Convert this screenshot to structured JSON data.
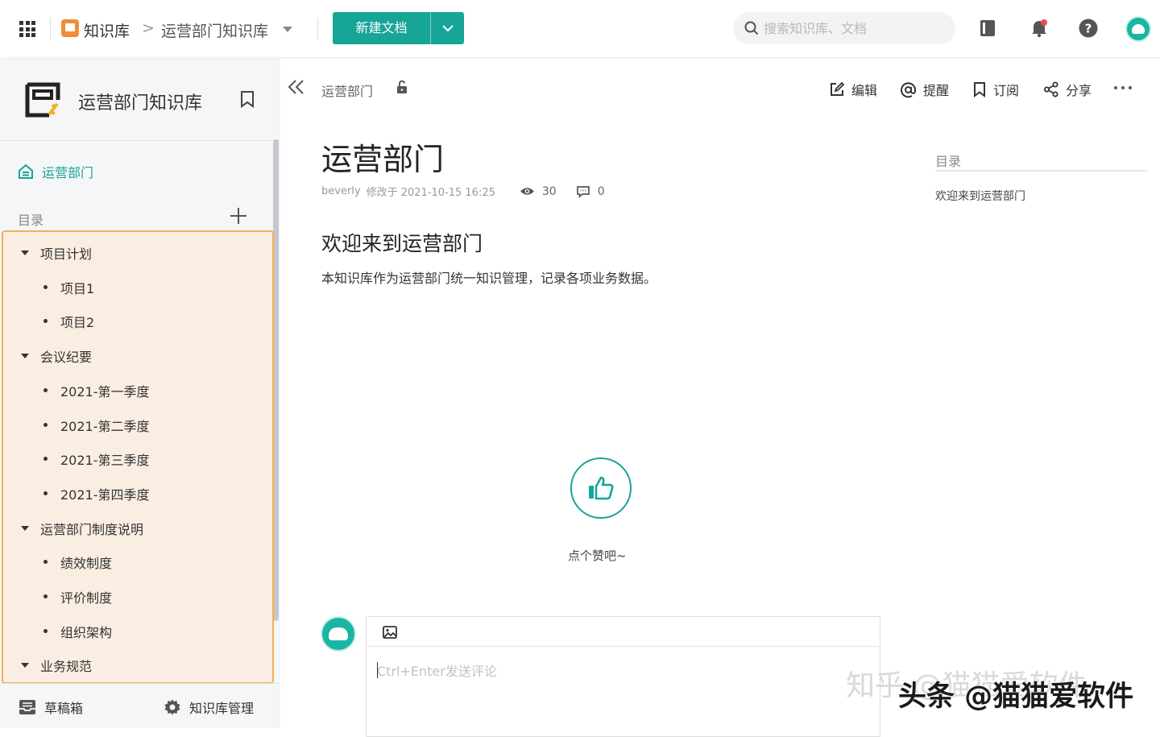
{
  "topbar": {
    "breadcrumb_root": "知识库",
    "breadcrumb_separator": ">",
    "breadcrumb_current": "运营部门知识库",
    "new_doc_label": "新建文档",
    "search_placeholder": "搜索知识库、文档"
  },
  "sidebar": {
    "kb_title": "运营部门知识库",
    "home_label": "运营部门",
    "toc_label": "目录",
    "tree": [
      {
        "label": "项目计划",
        "level": 0
      },
      {
        "label": "项目1",
        "level": 1
      },
      {
        "label": "项目2",
        "level": 1
      },
      {
        "label": "会议纪要",
        "level": 0
      },
      {
        "label": "2021-第一季度",
        "level": 1
      },
      {
        "label": "2021-第二季度",
        "level": 1
      },
      {
        "label": "2021-第三季度",
        "level": 1
      },
      {
        "label": "2021-第四季度",
        "level": 1
      },
      {
        "label": "运营部门制度说明",
        "level": 0
      },
      {
        "label": "绩效制度",
        "level": 1
      },
      {
        "label": "评价制度",
        "level": 1
      },
      {
        "label": "组织架构",
        "level": 1
      },
      {
        "label": "业务规范",
        "level": 0
      }
    ],
    "footer": {
      "drafts": "草稿箱",
      "manage": "知识库管理"
    }
  },
  "doc_header": {
    "breadcrumb": "运营部门",
    "actions": {
      "edit": "编辑",
      "mention": "提醒",
      "subscribe": "订阅",
      "share": "分享"
    }
  },
  "doc": {
    "title": "运营部门",
    "author": "beverly",
    "modified": "修改于 2021-10-15 16:25",
    "views": "30",
    "comments": "0",
    "heading": "欢迎来到运营部门",
    "body": "本知识库作为运营部门统一知识管理，记录各项业务数据。",
    "like_prompt": "点个赞吧~"
  },
  "toc": {
    "title": "目录",
    "items": [
      "欢迎来到运营部门"
    ]
  },
  "comment": {
    "placeholder": "Ctrl+Enter发送评论"
  },
  "watermarks": {
    "faded": "知乎 @猫猫爱软件",
    "main": "头条 @猫猫爱软件"
  },
  "colors": {
    "brand": "#17a597",
    "highlight_bg": "#faeee3",
    "highlight_border": "#f2b050",
    "kb_icon": "#f08c3a"
  }
}
